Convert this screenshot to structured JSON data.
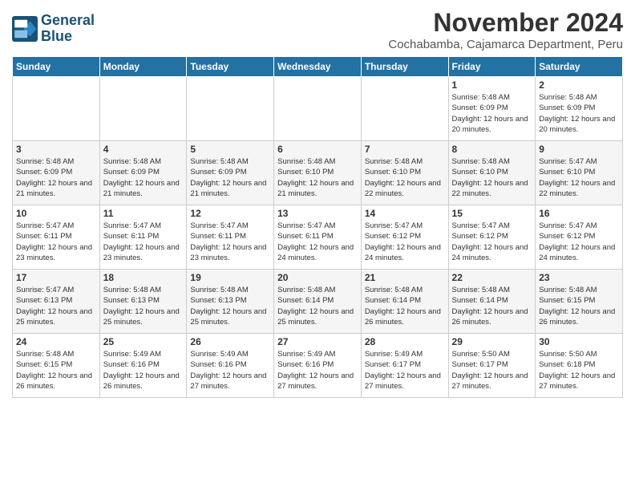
{
  "header": {
    "logo_line1": "General",
    "logo_line2": "Blue",
    "month": "November 2024",
    "location": "Cochabamba, Cajamarca Department, Peru"
  },
  "weekdays": [
    "Sunday",
    "Monday",
    "Tuesday",
    "Wednesday",
    "Thursday",
    "Friday",
    "Saturday"
  ],
  "weeks": [
    [
      {
        "day": "",
        "info": ""
      },
      {
        "day": "",
        "info": ""
      },
      {
        "day": "",
        "info": ""
      },
      {
        "day": "",
        "info": ""
      },
      {
        "day": "",
        "info": ""
      },
      {
        "day": "1",
        "info": "Sunrise: 5:48 AM\nSunset: 6:09 PM\nDaylight: 12 hours and 20 minutes."
      },
      {
        "day": "2",
        "info": "Sunrise: 5:48 AM\nSunset: 6:09 PM\nDaylight: 12 hours and 20 minutes."
      }
    ],
    [
      {
        "day": "3",
        "info": "Sunrise: 5:48 AM\nSunset: 6:09 PM\nDaylight: 12 hours and 21 minutes."
      },
      {
        "day": "4",
        "info": "Sunrise: 5:48 AM\nSunset: 6:09 PM\nDaylight: 12 hours and 21 minutes."
      },
      {
        "day": "5",
        "info": "Sunrise: 5:48 AM\nSunset: 6:09 PM\nDaylight: 12 hours and 21 minutes."
      },
      {
        "day": "6",
        "info": "Sunrise: 5:48 AM\nSunset: 6:10 PM\nDaylight: 12 hours and 21 minutes."
      },
      {
        "day": "7",
        "info": "Sunrise: 5:48 AM\nSunset: 6:10 PM\nDaylight: 12 hours and 22 minutes."
      },
      {
        "day": "8",
        "info": "Sunrise: 5:48 AM\nSunset: 6:10 PM\nDaylight: 12 hours and 22 minutes."
      },
      {
        "day": "9",
        "info": "Sunrise: 5:47 AM\nSunset: 6:10 PM\nDaylight: 12 hours and 22 minutes."
      }
    ],
    [
      {
        "day": "10",
        "info": "Sunrise: 5:47 AM\nSunset: 6:11 PM\nDaylight: 12 hours and 23 minutes."
      },
      {
        "day": "11",
        "info": "Sunrise: 5:47 AM\nSunset: 6:11 PM\nDaylight: 12 hours and 23 minutes."
      },
      {
        "day": "12",
        "info": "Sunrise: 5:47 AM\nSunset: 6:11 PM\nDaylight: 12 hours and 23 minutes."
      },
      {
        "day": "13",
        "info": "Sunrise: 5:47 AM\nSunset: 6:11 PM\nDaylight: 12 hours and 24 minutes."
      },
      {
        "day": "14",
        "info": "Sunrise: 5:47 AM\nSunset: 6:12 PM\nDaylight: 12 hours and 24 minutes."
      },
      {
        "day": "15",
        "info": "Sunrise: 5:47 AM\nSunset: 6:12 PM\nDaylight: 12 hours and 24 minutes."
      },
      {
        "day": "16",
        "info": "Sunrise: 5:47 AM\nSunset: 6:12 PM\nDaylight: 12 hours and 24 minutes."
      }
    ],
    [
      {
        "day": "17",
        "info": "Sunrise: 5:47 AM\nSunset: 6:13 PM\nDaylight: 12 hours and 25 minutes."
      },
      {
        "day": "18",
        "info": "Sunrise: 5:48 AM\nSunset: 6:13 PM\nDaylight: 12 hours and 25 minutes."
      },
      {
        "day": "19",
        "info": "Sunrise: 5:48 AM\nSunset: 6:13 PM\nDaylight: 12 hours and 25 minutes."
      },
      {
        "day": "20",
        "info": "Sunrise: 5:48 AM\nSunset: 6:14 PM\nDaylight: 12 hours and 25 minutes."
      },
      {
        "day": "21",
        "info": "Sunrise: 5:48 AM\nSunset: 6:14 PM\nDaylight: 12 hours and 26 minutes."
      },
      {
        "day": "22",
        "info": "Sunrise: 5:48 AM\nSunset: 6:14 PM\nDaylight: 12 hours and 26 minutes."
      },
      {
        "day": "23",
        "info": "Sunrise: 5:48 AM\nSunset: 6:15 PM\nDaylight: 12 hours and 26 minutes."
      }
    ],
    [
      {
        "day": "24",
        "info": "Sunrise: 5:48 AM\nSunset: 6:15 PM\nDaylight: 12 hours and 26 minutes."
      },
      {
        "day": "25",
        "info": "Sunrise: 5:49 AM\nSunset: 6:16 PM\nDaylight: 12 hours and 26 minutes."
      },
      {
        "day": "26",
        "info": "Sunrise: 5:49 AM\nSunset: 6:16 PM\nDaylight: 12 hours and 27 minutes."
      },
      {
        "day": "27",
        "info": "Sunrise: 5:49 AM\nSunset: 6:16 PM\nDaylight: 12 hours and 27 minutes."
      },
      {
        "day": "28",
        "info": "Sunrise: 5:49 AM\nSunset: 6:17 PM\nDaylight: 12 hours and 27 minutes."
      },
      {
        "day": "29",
        "info": "Sunrise: 5:50 AM\nSunset: 6:17 PM\nDaylight: 12 hours and 27 minutes."
      },
      {
        "day": "30",
        "info": "Sunrise: 5:50 AM\nSunset: 6:18 PM\nDaylight: 12 hours and 27 minutes."
      }
    ]
  ]
}
